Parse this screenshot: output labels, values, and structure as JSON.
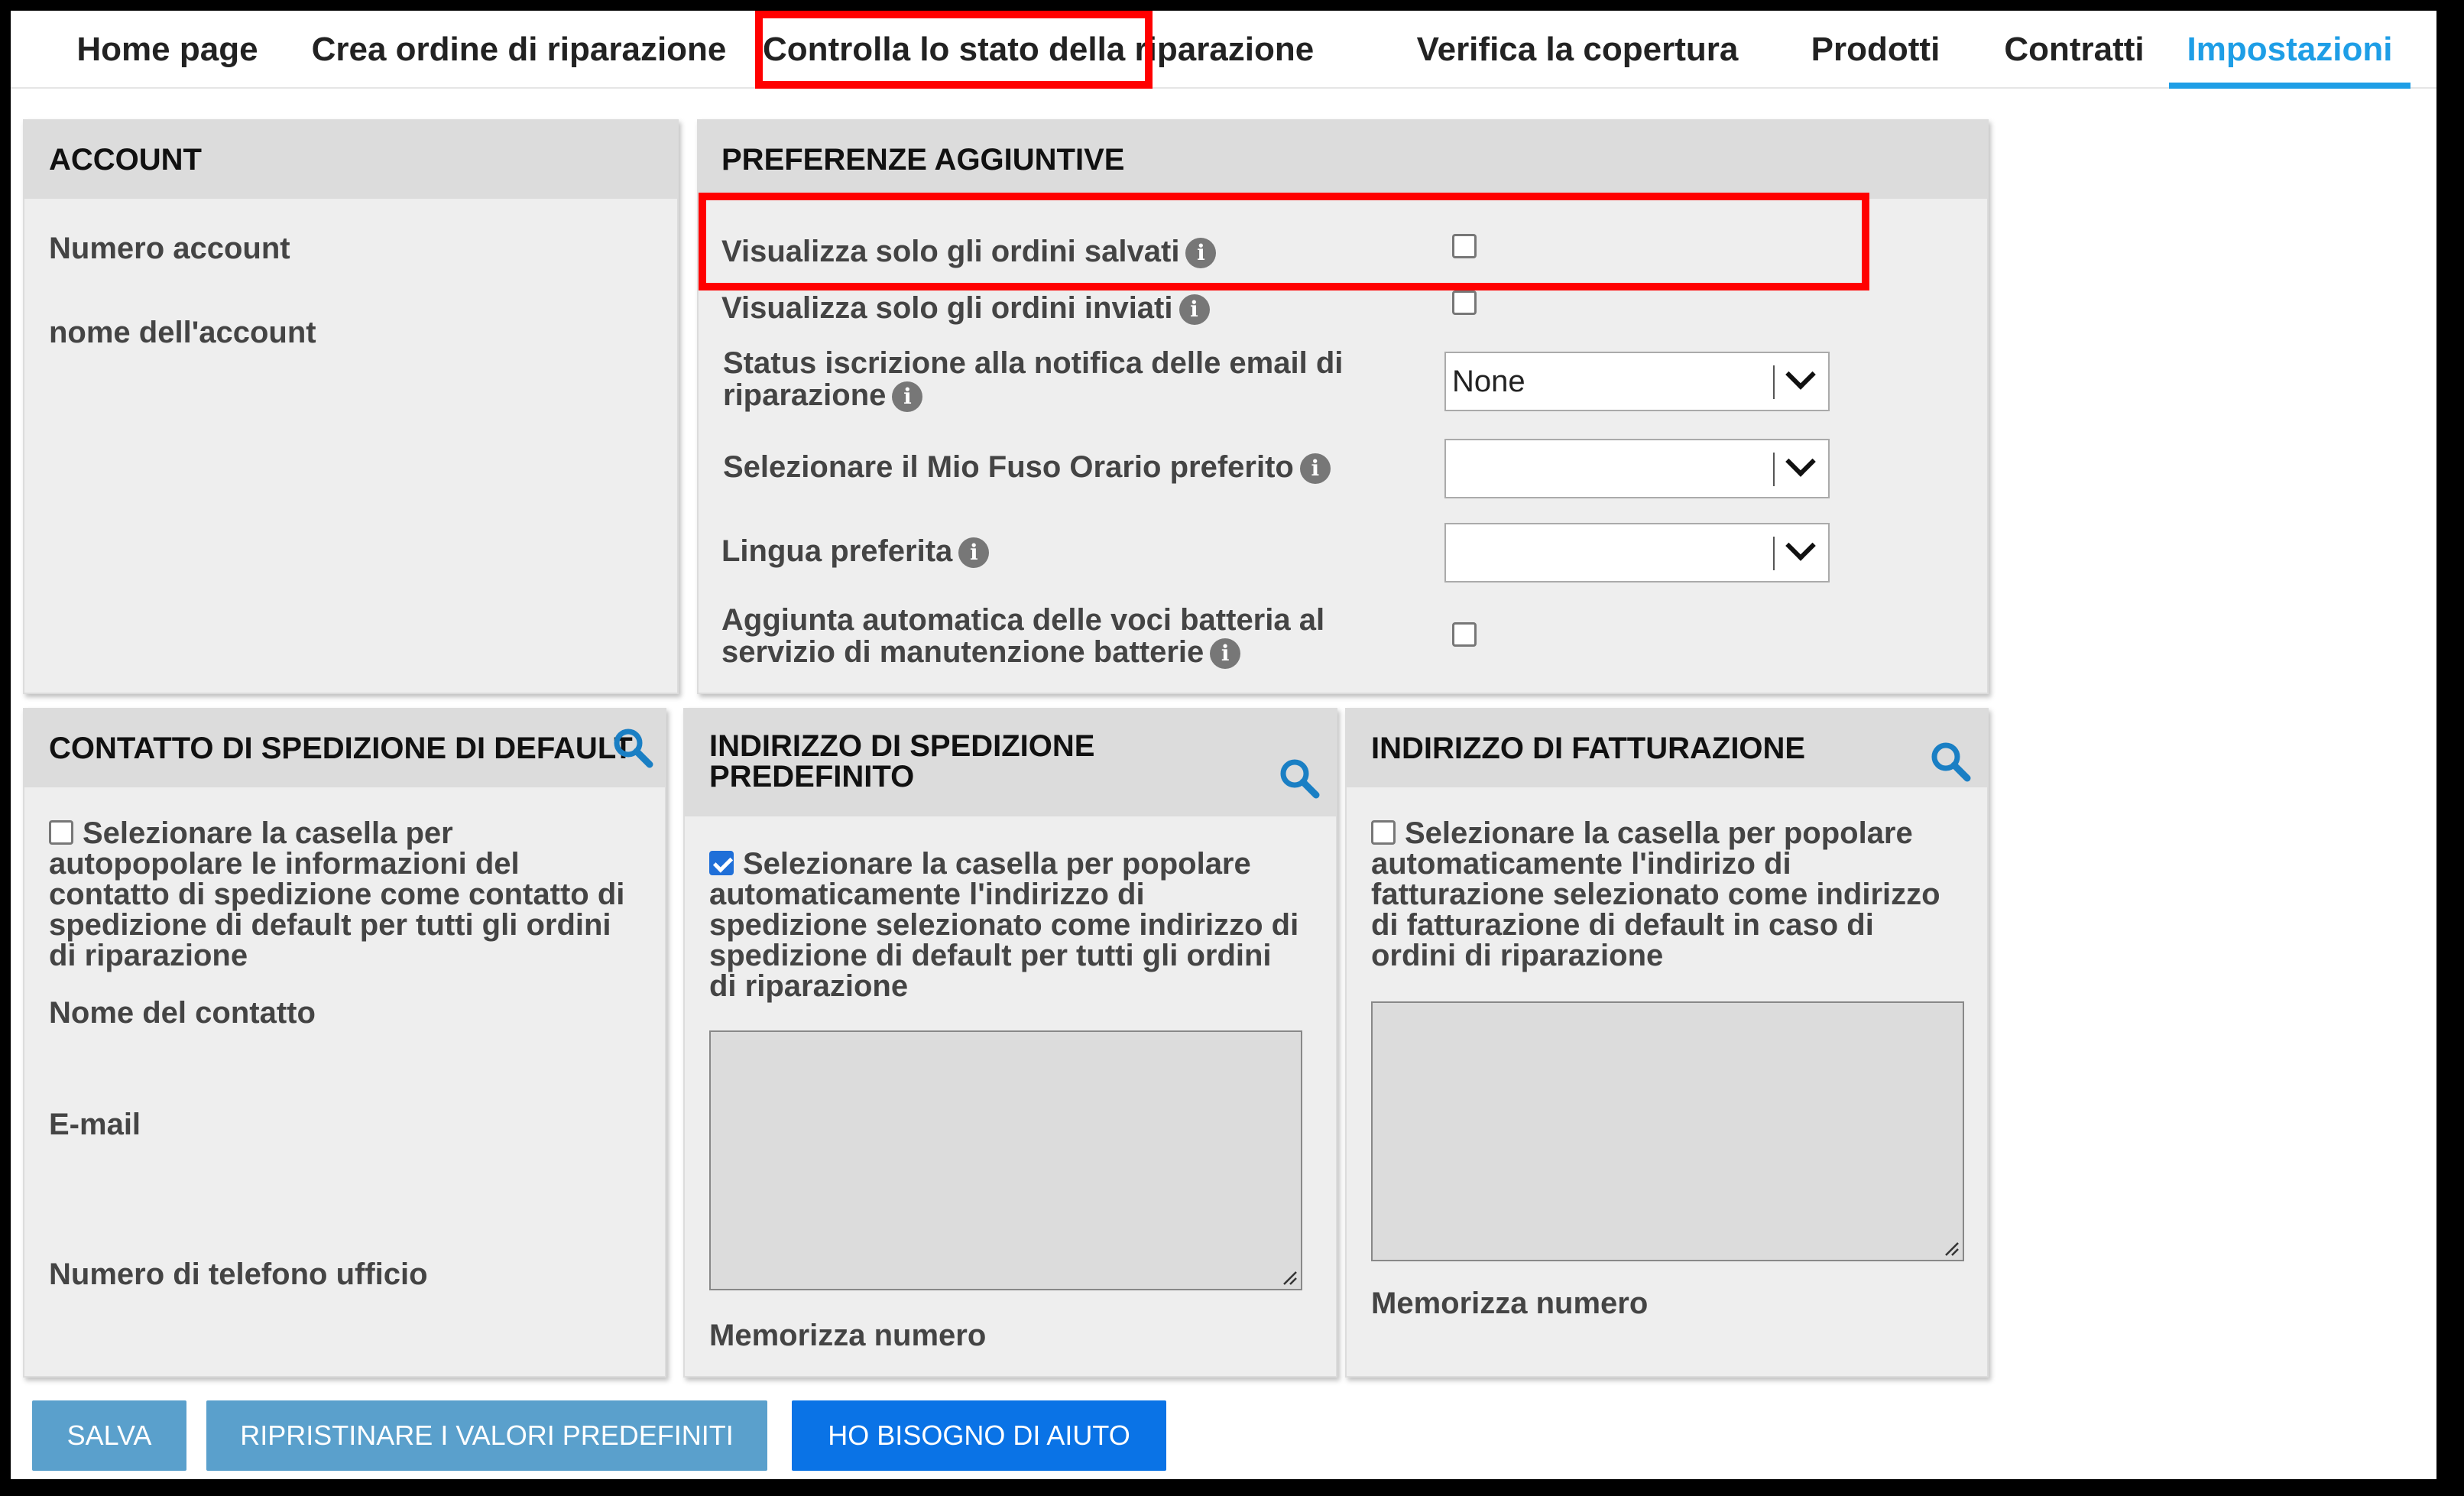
{
  "tabs": [
    "Home page",
    "Crea ordine di riparazione",
    "Controlla lo stato della riparazione",
    "Verifica la copertura",
    "Prodotti",
    "Contratti",
    "Impostazioni"
  ],
  "active_tab": "Impostazioni",
  "highlighted_tab": "Controlla lo stato della riparazione",
  "account": {
    "title": "ACCOUNT",
    "number_label": "Numero account",
    "name_label": "nome dell'account"
  },
  "preferences": {
    "title": "PREFERENZE AGGIUNTIVE",
    "saved_only_label": "Visualizza solo gli ordini salvati",
    "sent_only_label": "Visualizza solo gli ordini inviati",
    "email_status_label_1": "Status iscrizione alla notifica delle email di",
    "email_status_label_2": "riparazione",
    "email_status_value": "None",
    "timezone_label": "Selezionare il Mio Fuso Orario preferito",
    "timezone_value": "",
    "language_label": "Lingua preferita",
    "language_value": "",
    "battery_label_1": "Aggiunta automatica delle voci batteria al",
    "battery_label_2": "servizio di manutenzione batterie",
    "saved_only_checked": false,
    "sent_only_checked": false,
    "battery_checked": false
  },
  "shipping_contact": {
    "title": "CONTATTO DI SPEDIZIONE DI DEFAULT",
    "checkbox_text": "Selezionare la casella per autopopolare le informazioni del contatto di spedizione come contatto di spedizione di default per tutti gli ordini di riparazione",
    "checked": false,
    "contact_name_label": "Nome del contatto",
    "email_label": "E-mail",
    "phone_label": "Numero di telefono ufficio"
  },
  "shipping_address": {
    "title_1": "INDIRIZZO DI SPEDIZIONE",
    "title_2": "PREDEFINITO",
    "checkbox_text": "Selezionare la casella per popolare automaticamente l'indirizzo di spedizione selezionato come indirizzo di spedizione di default per tutti gli ordini di riparazione",
    "checked": true,
    "store_label": "Memorizza numero"
  },
  "billing_address": {
    "title": "INDIRIZZO DI FATTURAZIONE",
    "checkbox_text": "Selezionare la casella per popolare automaticamente l'indirizo di fatturazione selezionato come indirizzo di fatturazione di default in caso di ordini di riparazione",
    "checked": false,
    "store_label": "Memorizza numero"
  },
  "buttons": {
    "save": "SALVA",
    "reset": "RIPRISTINARE I VALORI PREDEFINITI",
    "help": "HO BISOGNO DI AIUTO"
  },
  "icons": {
    "info": "info-icon",
    "search": "search-icon",
    "dropdown": "chevron-down-icon"
  },
  "colors": {
    "accent": "#1e9ee6",
    "highlight": "#ff0000",
    "help_button": "#0a73e6",
    "secondary_button": "#5aa0cc"
  }
}
